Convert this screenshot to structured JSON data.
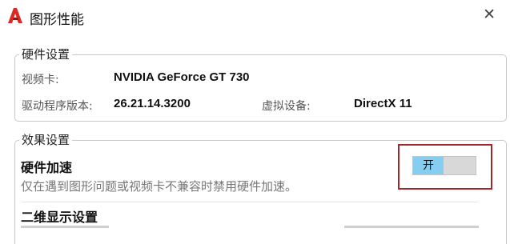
{
  "window": {
    "title": "图形性能",
    "close_glyph": "✕",
    "app_icon": "autocad-a-icon",
    "app_icon_color": "#d92a24"
  },
  "hardware": {
    "legend": "硬件设置",
    "graphics_card_label": "视频卡:",
    "graphics_card_value": "NVIDIA GeForce GT 730",
    "driver_version_label": "驱动程序版本:",
    "driver_version_value": "26.21.14.3200",
    "virtual_device_label": "虚拟设备:",
    "virtual_device_value": "DirectX 11"
  },
  "effects": {
    "legend": "效果设置",
    "hw_accel_title": "硬件加速",
    "hw_accel_desc": "仅在遇到图形问题或视频卡不兼容时禁用硬件加速。",
    "toggle_label": "开",
    "toggle_state": "on",
    "toggle_color": "#86cef0",
    "highlight_color": "#a4282b",
    "display_2d_title": "二维显示设置"
  }
}
